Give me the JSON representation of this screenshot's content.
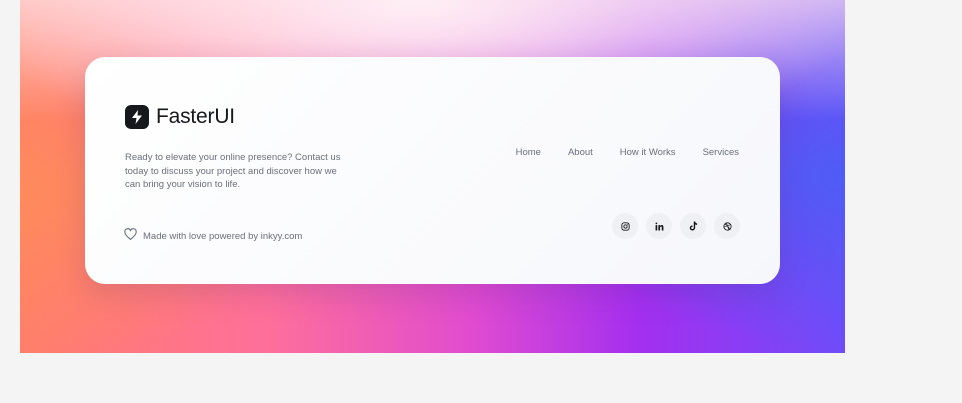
{
  "brand": {
    "name": "FasterUI",
    "logo_icon": "lightning-bolt-icon"
  },
  "tagline": "Ready to elevate your online presence? Contact us today to discuss your project and discover how we can bring your vision to life.",
  "nav": {
    "items": [
      {
        "label": "Home"
      },
      {
        "label": "About"
      },
      {
        "label": "How it Works"
      },
      {
        "label": "Services"
      }
    ]
  },
  "footer_note": {
    "icon": "heart-icon",
    "text": "Made with love powered by inkyy.com"
  },
  "socials": [
    {
      "icon": "instagram-icon"
    },
    {
      "icon": "linkedin-icon"
    },
    {
      "icon": "tiktok-icon"
    },
    {
      "icon": "dribbble-icon"
    }
  ],
  "colors": {
    "text_primary": "#17181c",
    "text_muted": "#6b6f7b",
    "card_bg": "#ffffff",
    "social_bg": "#eef0f4"
  }
}
